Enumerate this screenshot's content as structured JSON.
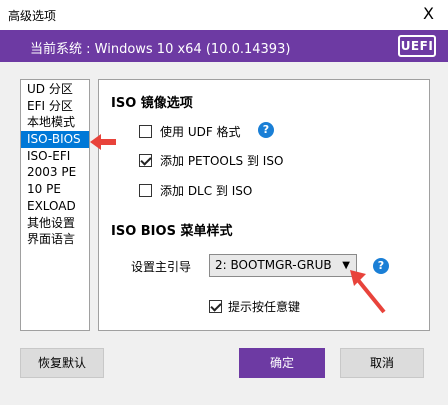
{
  "window": {
    "title": "高级选项",
    "close_glyph": "X"
  },
  "banner": {
    "system_text": "当前系统 : Windows 10 x64 (10.0.14393)",
    "badge": "UEFI",
    "color": "#6d3aa3"
  },
  "sidebar": {
    "items": [
      {
        "label": "UD 分区"
      },
      {
        "label": "EFI 分区"
      },
      {
        "label": "本地模式"
      },
      {
        "label": "ISO-BIOS"
      },
      {
        "label": "ISO-EFI"
      },
      {
        "label": "2003 PE"
      },
      {
        "label": "10 PE"
      },
      {
        "label": "EXLOAD"
      },
      {
        "label": "其他设置"
      },
      {
        "label": "界面语言"
      }
    ],
    "selected_index": 3
  },
  "iso_options": {
    "title": "ISO 镜像选项",
    "checkboxes": [
      {
        "label": "使用 UDF 格式",
        "checked": false
      },
      {
        "label": "添加 PETOOLS 到 ISO",
        "checked": true
      },
      {
        "label": "添加 DLC 到 ISO",
        "checked": false
      }
    ]
  },
  "menu_style": {
    "title": "ISO BIOS 菜单样式",
    "boot_label": "设置主引导",
    "boot_value": "2: BOOTMGR-GRUB",
    "hotkey_label": "提示按任意键",
    "hotkey_checked": true
  },
  "buttons": {
    "restore": "恢复默认",
    "ok": "确定",
    "cancel": "取消"
  },
  "help_glyph": "?",
  "accent_red": "#e8433b"
}
